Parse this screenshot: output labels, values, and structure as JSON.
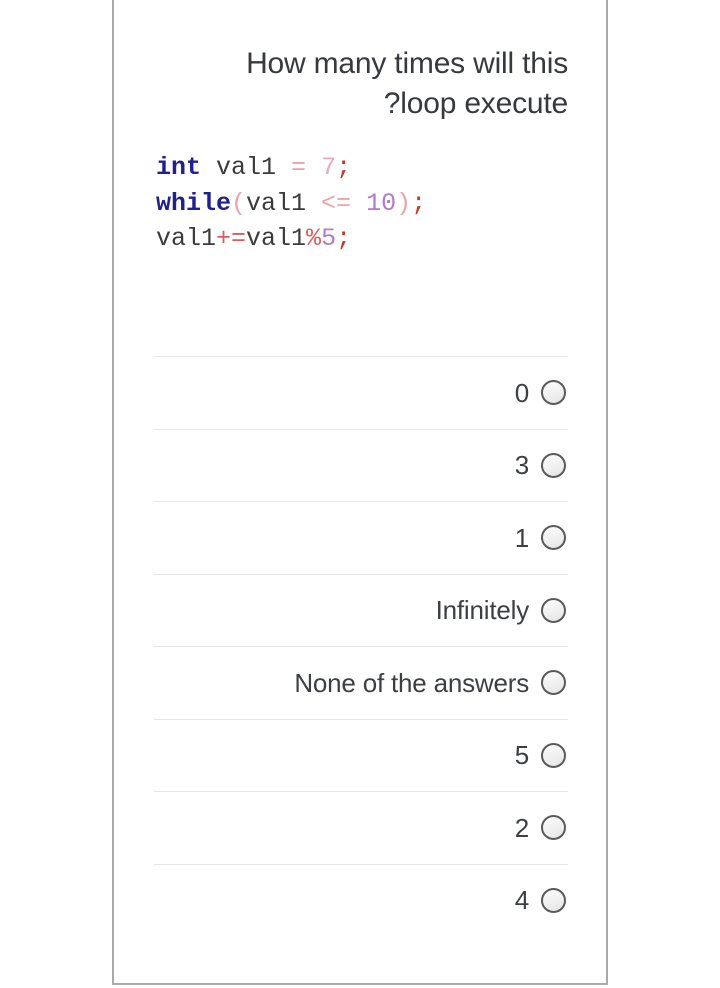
{
  "card": {
    "question_title": "How many times will this ?loop execute",
    "question_title_line1": "How many times will this",
    "question_title_line2": "?loop execute"
  },
  "code": {
    "language": "c",
    "lines": [
      {
        "tokens": [
          {
            "text": "int",
            "type": "keyword"
          },
          {
            "text": " val1 ",
            "type": "identifier"
          },
          {
            "text": "=",
            "type": "operator"
          },
          {
            "text": " ",
            "type": "identifier"
          },
          {
            "text": "7",
            "type": "number-light"
          },
          {
            "text": ";",
            "type": "semicolon"
          }
        ]
      },
      {
        "tokens": [
          {
            "text": "while",
            "type": "keyword"
          },
          {
            "text": "(",
            "type": "punctuation"
          },
          {
            "text": "val1 ",
            "type": "identifier"
          },
          {
            "text": "<=",
            "type": "operator"
          },
          {
            "text": " ",
            "type": "identifier"
          },
          {
            "text": "10",
            "type": "number"
          },
          {
            "text": ")",
            "type": "punctuation"
          },
          {
            "text": ";",
            "type": "semicolon"
          }
        ]
      },
      {
        "tokens": [
          {
            "text": "val1",
            "type": "identifier"
          },
          {
            "text": "+=",
            "type": "operator-strong"
          },
          {
            "text": "val1",
            "type": "identifier"
          },
          {
            "text": "%",
            "type": "operator-strong"
          },
          {
            "text": "5",
            "type": "number"
          },
          {
            "text": ";",
            "type": "semicolon"
          }
        ]
      }
    ],
    "plain_text": "int val1 = 7;\nwhile(val1 <= 10);\nval1+=val1%5;"
  },
  "options": [
    {
      "label": "0",
      "selected": false
    },
    {
      "label": "3",
      "selected": false
    },
    {
      "label": "1",
      "selected": false
    },
    {
      "label": "Infinitely",
      "selected": false
    },
    {
      "label": "None of the answers",
      "selected": false
    },
    {
      "label": "5",
      "selected": false
    },
    {
      "label": "2",
      "selected": false
    },
    {
      "label": "4",
      "selected": false
    }
  ],
  "colors": {
    "card_border": "#a9a9a9",
    "divider": "#e6e6e8",
    "title_text": "#36393d",
    "option_text": "#3c3f43",
    "code_keyword": "#21218c",
    "code_identifier": "#3b3b3b",
    "code_number": "#b07bc9",
    "code_number_light": "#e8a8c0",
    "code_operator": "#e9a5ab",
    "code_operator_strong": "#e05a5a",
    "code_semicolon": "#c0392b",
    "radio_border": "#5a5a5a",
    "radio_fill": "#f0f0f0",
    "page_background": "#ffffff"
  }
}
